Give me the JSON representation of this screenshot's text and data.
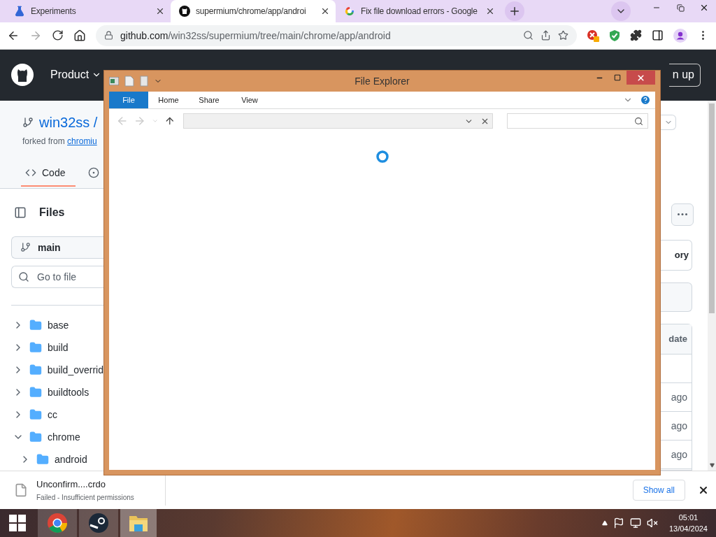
{
  "browser": {
    "tabs": [
      {
        "title": "Experiments",
        "kind": "flask",
        "selected": false
      },
      {
        "title": "supermium/chrome/app/androi",
        "kind": "github",
        "selected": true
      },
      {
        "title": "Fix file download errors - Google",
        "kind": "google",
        "selected": false
      }
    ],
    "address": {
      "host": "github.com",
      "path": "/win32ss/supermium/tree/main/chrome/app/android"
    }
  },
  "page": {
    "header": {
      "nav": "Product",
      "signup": "n up"
    },
    "repo": {
      "title": "win32ss /",
      "forked_prefix": "forked from",
      "forked_link": "chromiu"
    },
    "repo_tabs": [
      {
        "label": "Code",
        "selected": true
      }
    ],
    "files_title": "Files",
    "branch": "main",
    "search": {
      "placeholder": "Go to file"
    },
    "tree": [
      {
        "name": "base",
        "expanded": false
      },
      {
        "name": "build",
        "expanded": false
      },
      {
        "name": "build_overrid",
        "expanded": false
      },
      {
        "name": "buildtools",
        "expanded": false
      },
      {
        "name": "cc",
        "expanded": false
      },
      {
        "name": "chrome",
        "expanded": true,
        "children": [
          {
            "name": "android",
            "expanded": false
          }
        ]
      }
    ],
    "right": {
      "history": "ory",
      "column_header": "date",
      "rows": [
        "ago",
        "ago",
        "ago"
      ]
    }
  },
  "downloads": {
    "file": "Unconfirm....crdo",
    "status": "Failed - Insufficient permissions",
    "show_all": "Show all"
  },
  "explorer": {
    "title": "File Explorer",
    "tabs": [
      {
        "label": "File",
        "selected": true
      },
      {
        "label": "Home",
        "selected": false
      },
      {
        "label": "Share",
        "selected": false
      },
      {
        "label": "View",
        "selected": false
      }
    ]
  },
  "taskbar": {
    "time": "05:01",
    "date": "13/04/2024"
  }
}
